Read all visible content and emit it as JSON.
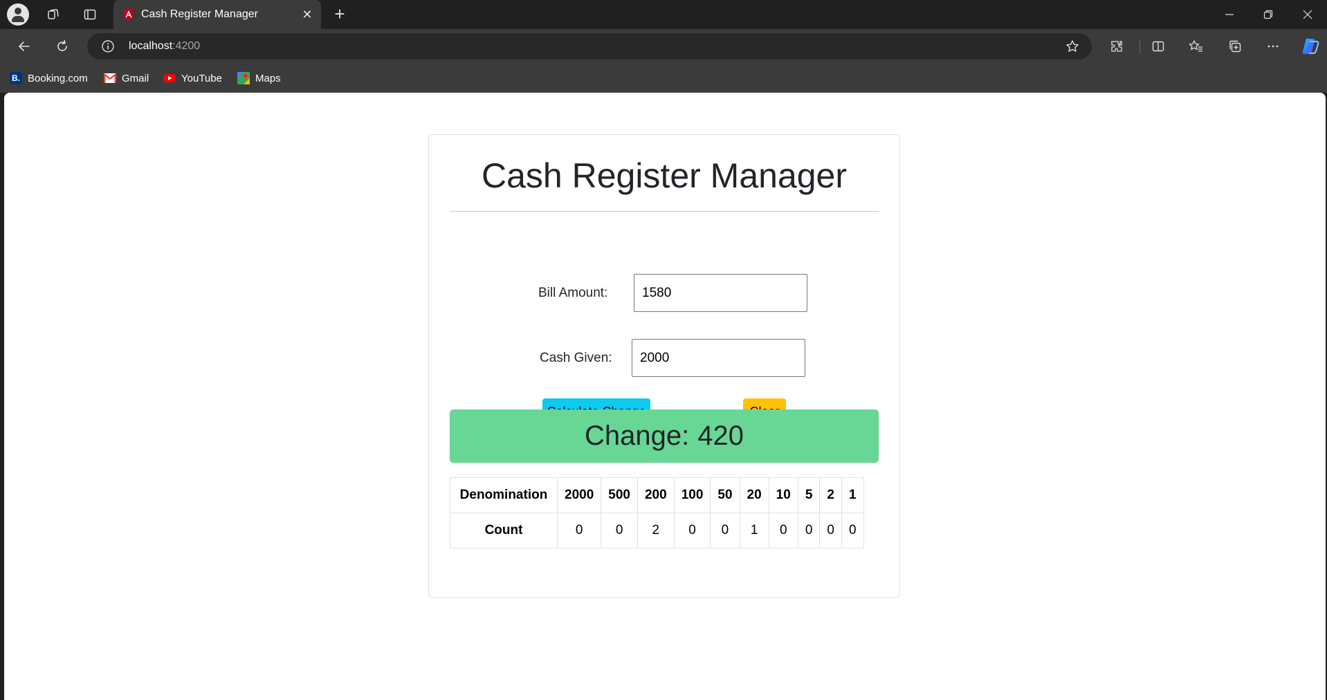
{
  "browser": {
    "tab_title": "Cash Register Manager",
    "url_host": "localhost",
    "url_port": ":4200",
    "bookmarks": [
      {
        "label": "Booking.com",
        "icon": "booking-icon"
      },
      {
        "label": "Gmail",
        "icon": "gmail-icon"
      },
      {
        "label": "YouTube",
        "icon": "youtube-icon"
      },
      {
        "label": "Maps",
        "icon": "maps-icon"
      }
    ]
  },
  "page": {
    "title": "Cash Register Manager",
    "bill_label": "Bill Amount:",
    "bill_value": "1580",
    "cash_label": "Cash Given:",
    "cash_value": "2000",
    "calc_button": "Calculate Change",
    "clear_button": "Clear",
    "change_label": "Change:",
    "change_value": "420",
    "table": {
      "row1_header": "Denomination",
      "row2_header": "Count",
      "denominations": [
        "2000",
        "500",
        "200",
        "100",
        "50",
        "20",
        "10",
        "5",
        "2",
        "1"
      ],
      "counts": [
        "0",
        "0",
        "2",
        "0",
        "0",
        "1",
        "0",
        "0",
        "0",
        "0"
      ]
    }
  },
  "colors": {
    "calc_button": "#0dcaf0",
    "clear_button": "#ffc107",
    "change_banner": "#68d695"
  }
}
